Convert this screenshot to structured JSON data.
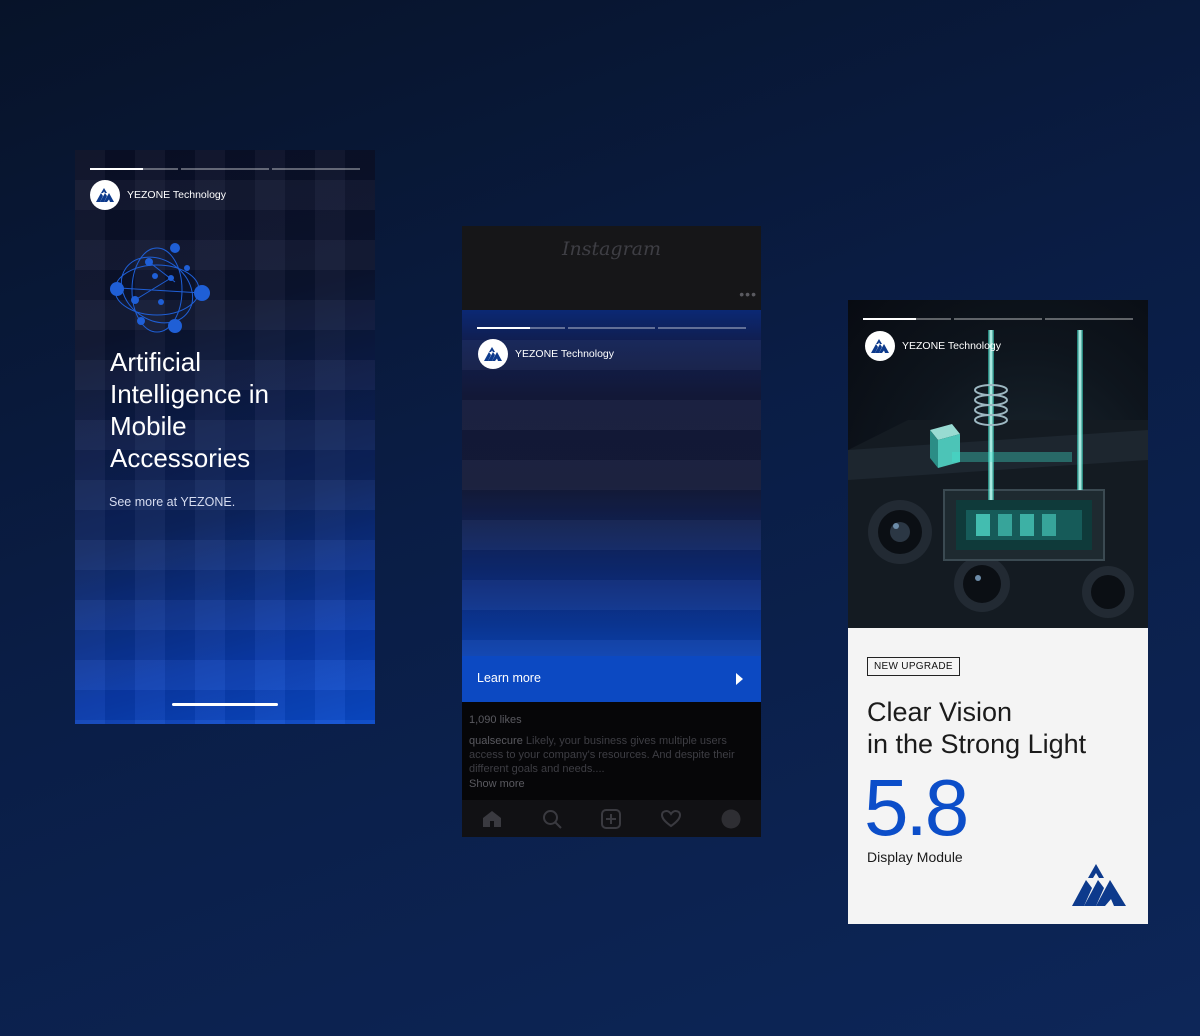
{
  "brand": {
    "name": "YEZONE Technology"
  },
  "story_ai": {
    "headline_lines": [
      "Artificial",
      "Intelligence in",
      "Mobile",
      "Accessories"
    ],
    "subtext": "See more at YEZONE."
  },
  "instagram": {
    "app_logo": "Instagram",
    "cta_label": "Learn more",
    "likes": "1,090 likes",
    "caption_user": "qualsecure",
    "caption_text": "Likely, your business gives multiple users access to your company's resources. And despite their different goals and needs....",
    "show_more": "Show more",
    "nav_icons": [
      "home-icon",
      "search-icon",
      "add-post-icon",
      "heart-icon",
      "profile-icon"
    ]
  },
  "story_display": {
    "badge": "NEW UPGRADE",
    "headline_lines": [
      "Clear Vision",
      "in the Strong Light"
    ],
    "value": "5.8",
    "value_caption": "Display Module"
  },
  "colors": {
    "accent_blue": "#0c4ec9",
    "background_navy": "#0a1d45",
    "logo_blue": "#0d3a8c"
  }
}
